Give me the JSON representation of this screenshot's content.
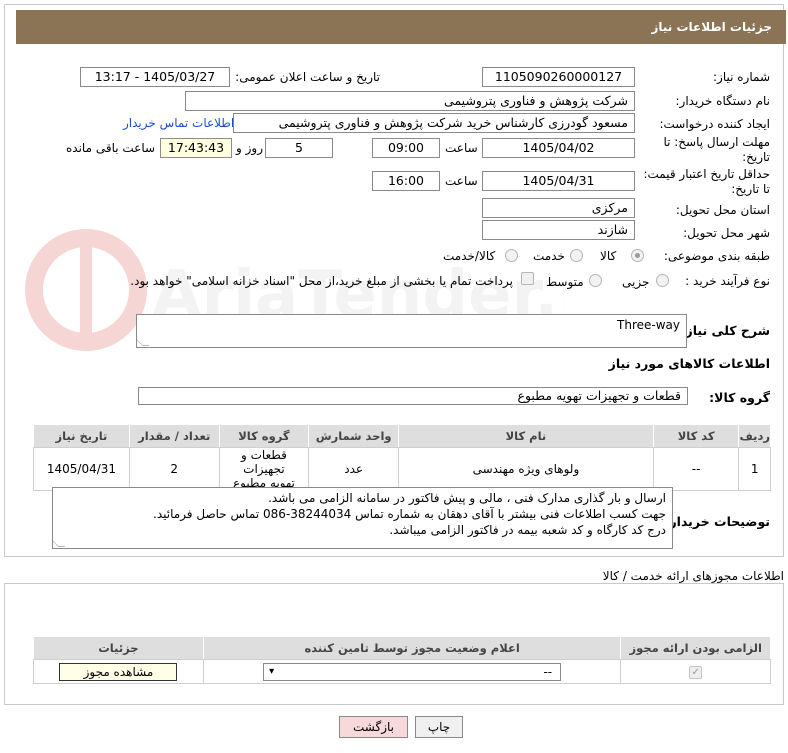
{
  "header": {
    "title": "جزئیات اطلاعات نیاز"
  },
  "fields": {
    "need_number_label": "شماره نیاز:",
    "need_number": "1105090260000127",
    "announce_label": "تاریخ و ساعت اعلان عمومی:",
    "announce_value": "1405/03/27 - 13:17",
    "buyer_org_label": "نام دستگاه خریدار:",
    "buyer_org": "شرکت پژوهش و فناوری پتروشیمی",
    "requester_label": "ایجاد کننده درخواست:",
    "requester": "مسعود گودرزی کارشناس خرید شرکت پژوهش و فناوری پتروشیمی",
    "contact_link": "اطلاعات تماس خریدار",
    "deadline_label": "مهلت ارسال پاسخ: تا تاریخ:",
    "deadline_date": "1405/04/02",
    "time_label": "ساعت",
    "deadline_time": "09:00",
    "days_value": "5",
    "days_label": "روز و",
    "remaining_time": "17:43:43",
    "remaining_label": "ساعت باقی مانده",
    "price_valid_label": "حداقل تاریخ اعتبار قیمت: تا تاریخ:",
    "price_valid_date": "1405/04/31",
    "price_valid_time": "16:00",
    "province_label": "استان محل تحویل:",
    "province": "مرکزی",
    "city_label": "شهر محل تحویل:",
    "city": "شازند",
    "category_label": "طبقه بندی موضوعی:",
    "category_options": [
      "کالا",
      "خدمت",
      "کالا/خدمت"
    ],
    "process_label": "نوع فرآیند خرید :",
    "process_options": [
      "جزیی",
      "متوسط"
    ],
    "payment_note": "پرداخت تمام یا بخشی از مبلغ خرید،از محل \"اسناد خزانه اسلامی\" خواهد بود."
  },
  "description": {
    "label": "شرح کلی نیاز:",
    "value": "Three-way"
  },
  "goods": {
    "section_title": "اطلاعات کالاهای مورد نیاز",
    "group_label": "گروه کالا:",
    "group_value": "قطعات و تجهیزات تهویه مطبوع",
    "columns": [
      "ردیف",
      "کد کالا",
      "نام کالا",
      "واحد شمارش",
      "گروه کالا",
      "تعداد / مقدار",
      "تاریخ نیاز"
    ],
    "rows": [
      {
        "row": "1",
        "code": "--",
        "name": "ولوهای ویژه مهندسی",
        "unit": "عدد",
        "group_line1": "قطعات و تجهیزات",
        "group_line2": "تهویه مطبوع",
        "qty": "2",
        "date": "1405/04/31"
      }
    ]
  },
  "buyer_notes": {
    "label": "توضیحات خریدار:",
    "line1": "ارسال و بار گذاری مدارک فنی ، مالی و پیش فاکتور در سامانه الزامی می باشد.",
    "line2": "جهت کسب اطلاعات فنی بیشتر با آقای دهقان به شماره تماس 38244034-086 تماس حاصل فرمائید.",
    "line3": "درج کد کارگاه و کد شعبه بیمه  در فاکتور الزامی میباشد."
  },
  "permits": {
    "section_title": "اطلاعات مجوزهای ارائه خدمت / کالا",
    "columns": [
      "الزامی بودن ارائه مجوز",
      "اعلام وضعیت مجوز توسط تامین کننده",
      "جزئیات"
    ],
    "select_value": "--",
    "view_button": "مشاهده مجوز"
  },
  "footer": {
    "print_button": "چاپ",
    "back_button": "بازگشت"
  },
  "watermark": {
    "text": "AriaTender.neT"
  },
  "colors": {
    "header": "#8b7355",
    "link": "#1a4fd0",
    "back_button": "#f7d9d9"
  }
}
